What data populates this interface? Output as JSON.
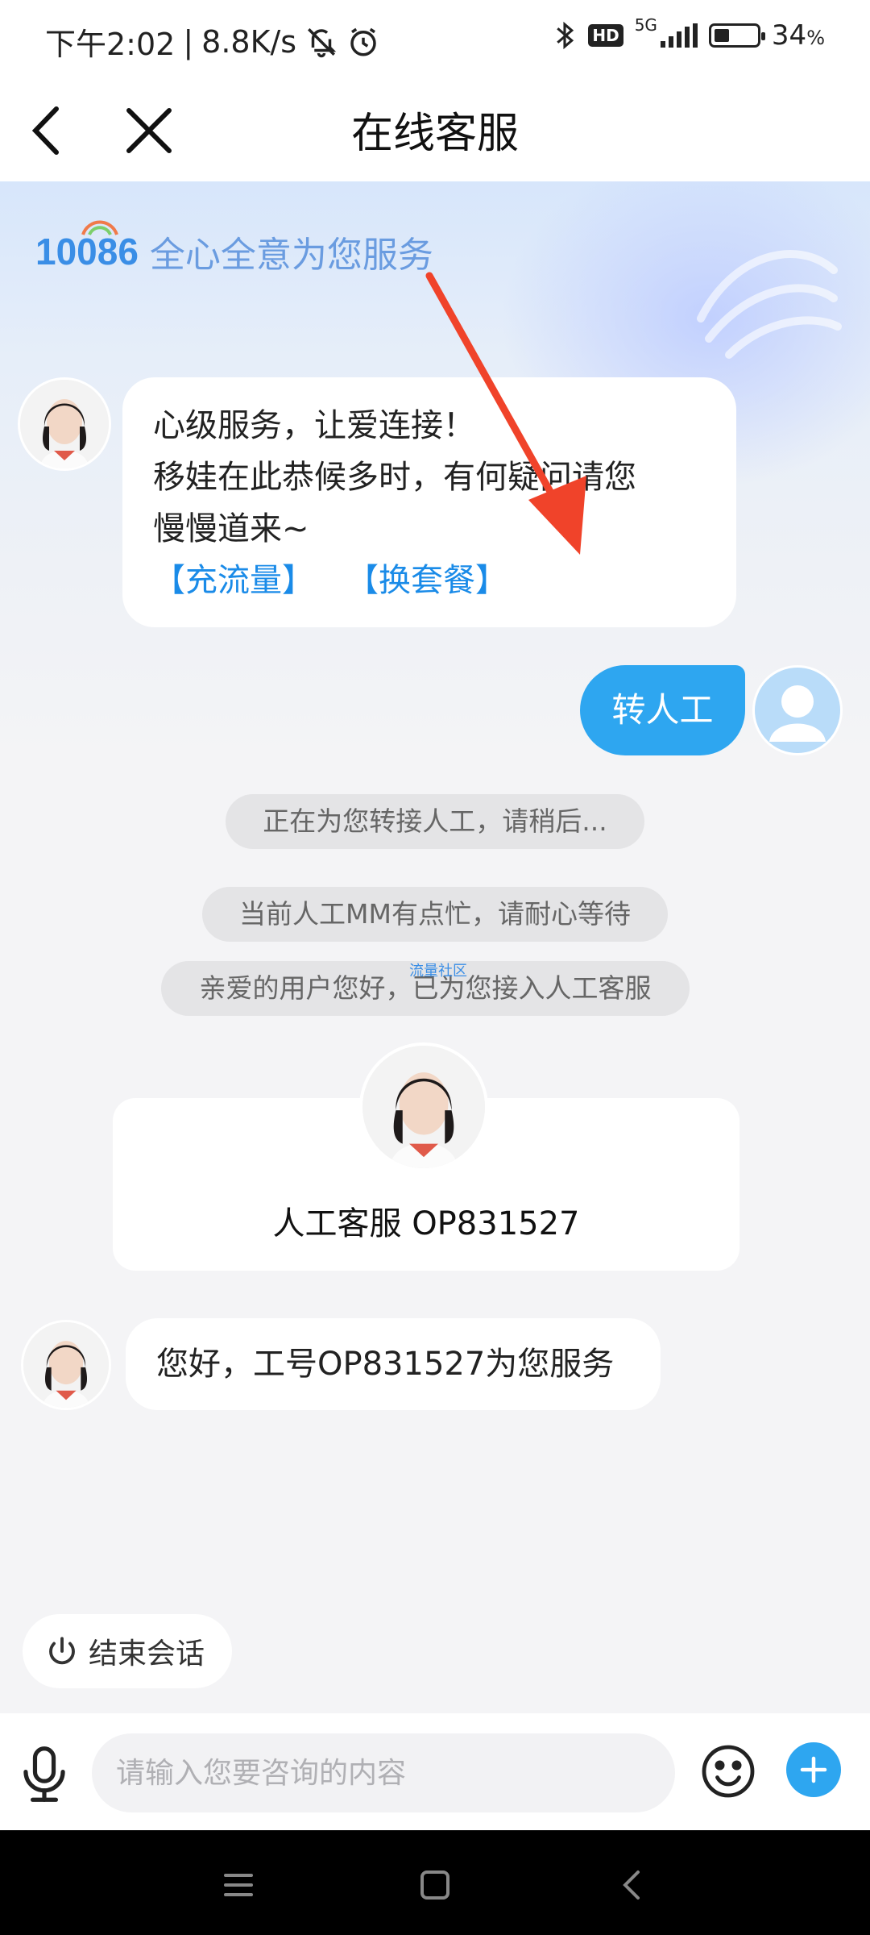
{
  "status_bar": {
    "time": "下午2:02",
    "separator": "|",
    "net_speed": "8.8K/s",
    "network": "5G",
    "hd": "HD",
    "battery_level": 0.34,
    "battery_pct": "34",
    "battery_unit": "%"
  },
  "header": {
    "title": "在线客服"
  },
  "hero": {
    "brand_number": "10086",
    "slogan": "全心全意为您服务"
  },
  "messages": {
    "welcome": {
      "line1": "心级服务，让爱连接！",
      "line2": "移娃在此恭候多时，有何疑问请您",
      "line3": "慢慢道来~",
      "link1": "【充流量】",
      "link2": "【换套餐】"
    },
    "user_msg": "转人工",
    "system_notices": [
      "正在为您转接人工，请稍后...",
      "当前人工MM有点忙，请耐心等待",
      "亲爱的用户您好，已为您接入人工客服"
    ],
    "watermark": "流量社区",
    "agent_card_name": "人工客服 OP831527",
    "agent_greeting": "您好，工号OP831527为您服务"
  },
  "actions": {
    "end_chat": "结束会话"
  },
  "input": {
    "placeholder": "请输入您要咨询的内容"
  },
  "colors": {
    "accent": "#2ea6f0",
    "link": "#1a8be8",
    "annotation_arrow": "#f0432a"
  },
  "icons": [
    "back-arrow-icon",
    "close-icon",
    "bluetooth-icon",
    "mute-icon",
    "alarm-icon",
    "microphone-icon",
    "emoji-icon",
    "plus-icon",
    "power-icon",
    "menu-icon",
    "home-icon",
    "back-icon"
  ]
}
